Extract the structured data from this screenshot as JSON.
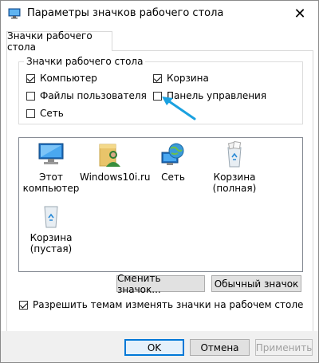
{
  "window": {
    "title": "Параметры значков рабочего стола"
  },
  "tab": {
    "label": "Значки рабочего стола"
  },
  "group": {
    "legend": "Значки рабочего стола",
    "checkboxes": [
      {
        "label": "Компьютер",
        "checked": true
      },
      {
        "label": "Корзина",
        "checked": true
      },
      {
        "label": "Файлы пользователя",
        "checked": false
      },
      {
        "label": "Панель управления",
        "checked": false
      },
      {
        "label": "Сеть",
        "checked": false
      }
    ]
  },
  "icons": [
    {
      "label": "Этот компьютер",
      "icon": "computer-icon"
    },
    {
      "label": "Windows10i.ru",
      "icon": "user-folder-icon"
    },
    {
      "label": "Сеть",
      "icon": "network-globe-icon"
    },
    {
      "label": "Корзина (полная)",
      "icon": "recycle-bin-full-icon"
    },
    {
      "label": "Корзина (пустая)",
      "icon": "recycle-bin-empty-icon"
    }
  ],
  "buttons": {
    "change_icon": "Сменить значок...",
    "default_icon": "Обычный значок",
    "ok": "OK",
    "cancel": "Отмена",
    "apply": "Применить"
  },
  "themes_checkbox": {
    "label": "Разрешить темам изменять значки на рабочем столе",
    "checked": true
  },
  "colors": {
    "accent": "#0078d7",
    "arrow": "#1aa1e0"
  }
}
